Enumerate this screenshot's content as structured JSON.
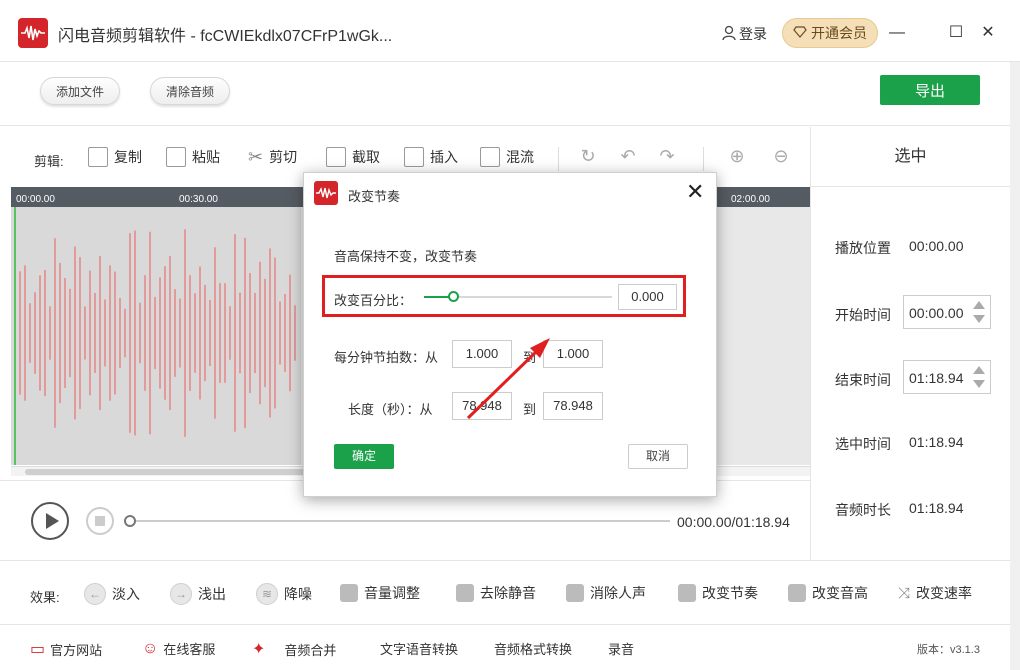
{
  "titlebar": {
    "app_title": "闪电音频剪辑软件 - fcCWIEkdlx07CFrP1wGk...",
    "login_label": "登录",
    "vip_label": "开通会员",
    "minimize_glyph": "—",
    "maximize_glyph": "☐",
    "close_glyph": "✕"
  },
  "toolbar": {
    "add_file_label": "添加文件",
    "clear_audio_label": "清除音频",
    "export_label": "导出"
  },
  "edit_toolbar": {
    "label": "剪辑:",
    "copy_label": "复制",
    "paste_label": "粘贴",
    "cut_label": "剪切",
    "crop_label": "截取",
    "insert_label": "插入",
    "mix_label": "混流"
  },
  "timeline": {
    "ticks": [
      "00:00.00",
      "00:30.00",
      "02:00.00"
    ]
  },
  "player": {
    "timecode": "00:00.00/01:18.94"
  },
  "right_panel": {
    "title": "选中",
    "play_position_label": "播放位置",
    "play_position_value": "00:00.00",
    "start_time_label": "开始时间",
    "start_time_value": "00:00.00",
    "end_time_label": "结束时间",
    "end_time_value": "01:18.94",
    "selected_time_label": "选中时间",
    "selected_time_value": "01:18.94",
    "duration_label": "音频时长",
    "duration_value": "01:18.94"
  },
  "effects": {
    "label": "效果:",
    "items": [
      "淡入",
      "浅出",
      "降噪",
      "音量调整",
      "去除静音",
      "消除人声",
      "改变节奏",
      "改变音高",
      "改变速率"
    ]
  },
  "bottom": {
    "official_site": "官方网站",
    "online_support": "在线客服",
    "audio_merge": "音频合并",
    "text_to_speech": "文字语音转换",
    "format_convert": "音频格式转换",
    "record": "录音",
    "version": "版本：v3.1.3"
  },
  "dialog": {
    "title": "改变节奏",
    "description": "音高保持不变，改变节奏",
    "percent_label": "改变百分比：",
    "percent_value": "0.000",
    "slider_level": 0.15,
    "bpm_label": "每分钟节拍数：从",
    "bpm_from": "1.000",
    "bpm_to_label": "到",
    "bpm_to": "1.000",
    "length_label": "长度（秒）：从",
    "length_from": "78.948",
    "length_to_label": "到",
    "length_to": "78.948",
    "ok_label": "确定",
    "cancel_label": "取消",
    "close_glyph": "✕"
  },
  "colors": {
    "brand_red": "#d3252a",
    "accent_green": "#1ba14a",
    "waveform": "#e29a9a",
    "highlight_red": "#e02020"
  }
}
